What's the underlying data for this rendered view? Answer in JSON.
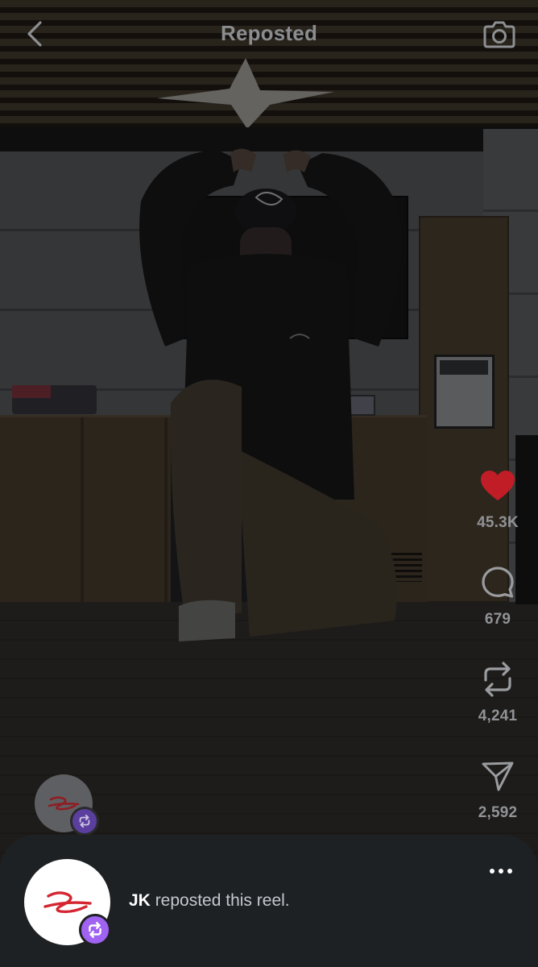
{
  "header": {
    "title": "Reposted",
    "back_icon": "chevron-left-icon",
    "camera_icon": "camera-icon"
  },
  "actions": {
    "like": {
      "icon": "heart-icon",
      "count": "45.3K",
      "color": "#e0242f",
      "liked": true
    },
    "comment": {
      "icon": "comment-bubble-icon",
      "count": "679"
    },
    "repost": {
      "icon": "repost-arrows-icon",
      "count": "4,241"
    },
    "share": {
      "icon": "send-paper-plane-icon",
      "count": "2,592"
    }
  },
  "reposter": {
    "username": "JK",
    "message": " reposted this reel.",
    "badge_color": "#a062f0"
  },
  "colors": {
    "sheet_background": "#1e2124",
    "muted_text": "#909296",
    "title_text": "#8a8c8f"
  }
}
